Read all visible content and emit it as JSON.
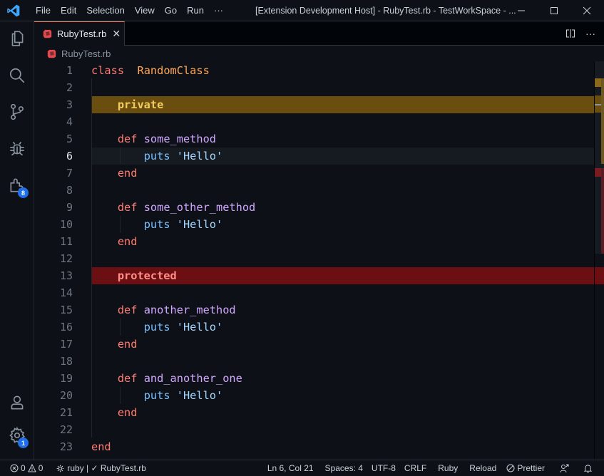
{
  "titlebar": {
    "menu": [
      "File",
      "Edit",
      "Selection",
      "View",
      "Go",
      "Run",
      "···"
    ],
    "window_title": "[Extension Development Host] - RubyTest.rb - TestWorkSpace - ...",
    "minimize_icon": "minimize-icon",
    "maximize_icon": "maximize-icon",
    "close_icon": "close-icon"
  },
  "activity_bar": {
    "items": [
      {
        "name": "explorer",
        "icon": "files-icon"
      },
      {
        "name": "search",
        "icon": "search-icon"
      },
      {
        "name": "source-control",
        "icon": "source-control-icon"
      },
      {
        "name": "run-debug",
        "icon": "bug-icon"
      },
      {
        "name": "extensions",
        "icon": "extensions-icon",
        "badge": "8"
      }
    ],
    "bottom": [
      {
        "name": "accounts",
        "icon": "account-icon"
      },
      {
        "name": "manage",
        "icon": "gear-icon",
        "badge": "1"
      }
    ]
  },
  "tabs": [
    {
      "label": "RubyTest.rb",
      "active": true,
      "icon": "ruby-icon"
    }
  ],
  "breadcrumb": {
    "file": "RubyTest.rb"
  },
  "editor": {
    "active_line": 6,
    "lines": [
      {
        "n": "1",
        "tokens": [
          [
            "kw",
            "class"
          ],
          [
            "",
            "  "
          ],
          [
            "cls",
            "RandomClass"
          ]
        ]
      },
      {
        "n": "2",
        "tokens": []
      },
      {
        "n": "3",
        "highlight": "private",
        "tokens": [
          [
            "",
            "    "
          ],
          [
            "priv",
            "private"
          ]
        ]
      },
      {
        "n": "4",
        "tokens": []
      },
      {
        "n": "5",
        "tokens": [
          [
            "",
            "    "
          ],
          [
            "kw",
            "def"
          ],
          [
            "",
            " "
          ],
          [
            "fn",
            "some_method"
          ]
        ]
      },
      {
        "n": "6",
        "tokens": [
          [
            "",
            "        "
          ],
          [
            "meth",
            "puts"
          ],
          [
            "",
            " "
          ],
          [
            "str",
            "'Hello'"
          ]
        ]
      },
      {
        "n": "7",
        "tokens": [
          [
            "",
            "    "
          ],
          [
            "kw",
            "end"
          ]
        ]
      },
      {
        "n": "8",
        "tokens": []
      },
      {
        "n": "9",
        "tokens": [
          [
            "",
            "    "
          ],
          [
            "kw",
            "def"
          ],
          [
            "",
            " "
          ],
          [
            "fn",
            "some_other_method"
          ]
        ]
      },
      {
        "n": "10",
        "tokens": [
          [
            "",
            "        "
          ],
          [
            "meth",
            "puts"
          ],
          [
            "",
            " "
          ],
          [
            "str",
            "'Hello'"
          ]
        ]
      },
      {
        "n": "11",
        "tokens": [
          [
            "",
            "    "
          ],
          [
            "kw",
            "end"
          ]
        ]
      },
      {
        "n": "12",
        "tokens": []
      },
      {
        "n": "13",
        "highlight": "protected",
        "tokens": [
          [
            "",
            "    "
          ],
          [
            "prot",
            "protected"
          ]
        ]
      },
      {
        "n": "14",
        "tokens": []
      },
      {
        "n": "15",
        "tokens": [
          [
            "",
            "    "
          ],
          [
            "kw",
            "def"
          ],
          [
            "",
            " "
          ],
          [
            "fn",
            "another_method"
          ]
        ]
      },
      {
        "n": "16",
        "tokens": [
          [
            "",
            "        "
          ],
          [
            "meth",
            "puts"
          ],
          [
            "",
            " "
          ],
          [
            "str",
            "'Hello'"
          ]
        ]
      },
      {
        "n": "17",
        "tokens": [
          [
            "",
            "    "
          ],
          [
            "kw",
            "end"
          ]
        ]
      },
      {
        "n": "18",
        "tokens": []
      },
      {
        "n": "19",
        "tokens": [
          [
            "",
            "    "
          ],
          [
            "kw",
            "def"
          ],
          [
            "",
            " "
          ],
          [
            "fn",
            "and_another_one"
          ]
        ]
      },
      {
        "n": "20",
        "tokens": [
          [
            "",
            "        "
          ],
          [
            "meth",
            "puts"
          ],
          [
            "",
            " "
          ],
          [
            "str",
            "'Hello'"
          ]
        ]
      },
      {
        "n": "21",
        "tokens": [
          [
            "",
            "    "
          ],
          [
            "kw",
            "end"
          ]
        ]
      },
      {
        "n": "22",
        "tokens": []
      },
      {
        "n": "23",
        "tokens": [
          [
            "kw",
            "end"
          ]
        ]
      }
    ]
  },
  "statusbar": {
    "errors": "0",
    "warnings": "0",
    "ruby_status": "ruby | ✓ RubyTest.rb",
    "position": "Ln 6, Col 21",
    "spaces": "Spaces: 4",
    "encoding": "UTF-8",
    "eol": "CRLF",
    "language": "Ruby",
    "reload": "Reload",
    "prettier": "Prettier"
  },
  "colors": {
    "private_highlight": "#6a4e0f",
    "protected_highlight": "#6b0f13",
    "accent_badge": "#1f6feb",
    "tab_border": "#f78166"
  }
}
